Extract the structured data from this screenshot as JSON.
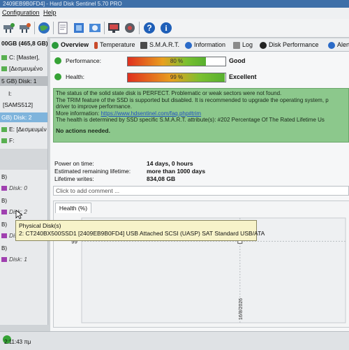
{
  "window": {
    "title": "2409EB9B0FD4] - Hard Disk Sentinel 5.70 PRO"
  },
  "menu": {
    "items": [
      "Configuration",
      "Help"
    ]
  },
  "toolbar": {
    "icons": [
      "drive-check-icon",
      "drive-refresh-icon",
      "globe-icon",
      "document-icon",
      "network-icon",
      "disk-info-icon",
      "monitor-icon",
      "settings-icon",
      "help-icon",
      "info-icon"
    ]
  },
  "sidebar": {
    "drive1_header": "00GB (465,8 GB)",
    "drive1_vol1": "C: [Master],",
    "drive1_vol2": "[Δεσμευμένο",
    "drive2_header": "5 GB) Disk: 1",
    "drive2_vol1": "I:",
    "drive2_vol2": "[SAMS512]",
    "drive3_header": "GB) Disk: 2",
    "drive3_vol1": "E: [Δεσμευμέν",
    "drive3_vol2": "F:",
    "phys0": "Disk: 0",
    "phys2": "Disk: 2",
    "phys2b": "Disk: 2",
    "phys1": "Disk: 1",
    "b_label": "B)"
  },
  "tabs": [
    {
      "label": "Overview",
      "icon": "check-icon",
      "color": "#2a9a3a"
    },
    {
      "label": "Temperature",
      "icon": "thermometer-icon",
      "color": "#c84a2a"
    },
    {
      "label": "S.M.A.R.T.",
      "icon": "smart-icon",
      "color": "#4a4a4a"
    },
    {
      "label": "Information",
      "icon": "info-icon",
      "color": "#2a6ac8"
    },
    {
      "label": "Log",
      "icon": "log-icon",
      "color": "#8a8a8a"
    },
    {
      "label": "Disk Performance",
      "icon": "disk-performance-icon",
      "color": "#222222"
    },
    {
      "label": "Alert",
      "icon": "alert-icon",
      "color": "#2a6ac8"
    }
  ],
  "overview": {
    "performance_label": "Performance:",
    "performance_value": "80 %",
    "performance_percent": 80,
    "performance_rating": "Good",
    "health_label": "Health:",
    "health_value": "99 %",
    "health_percent": 99,
    "health_rating": "Excellent",
    "status_lines": [
      "The status of the solid state disk is PERFECT. Problematic or weak sectors were not found.",
      "The TRIM feature of the SSD is supported but disabled. It is recommended to upgrade the operating system, p",
      "driver to improve performance.",
      "More information: ",
      "The health is determined by SSD specific S.M.A.R.T. attribute(s):  #202 Percentage Of The Rated Lifetime Us"
    ],
    "status_link": "https://www.hdsentinel.com/faq.php#trim",
    "status_action": "No actions needed.",
    "power_on_label": "Power on time:",
    "power_on_value": "14 days, 0 hours",
    "lifetime_remaining_label": "Estimated remaining lifetime:",
    "lifetime_remaining_value": "more than 1000 days",
    "lifetime_writes_label": "Lifetime writes:",
    "lifetime_writes_value": "834,08 GB",
    "comment_placeholder": "Click to add comment ...",
    "chart_tab": "Health (%)"
  },
  "tooltip": {
    "title": "Physical Disk(s)",
    "text": "2: CT240BX500SSD1 [2409EB9B0FD4] USB Attached SCSI (UASP) SAT Standard USB/ATA"
  },
  "statusbar": {
    "time": "2:11:43 πμ"
  },
  "chart_data": {
    "type": "line",
    "title": "Health (%)",
    "x": [
      "16/8/2026"
    ],
    "series": [
      {
        "values": [
          99
        ]
      }
    ],
    "ytick": "99"
  }
}
